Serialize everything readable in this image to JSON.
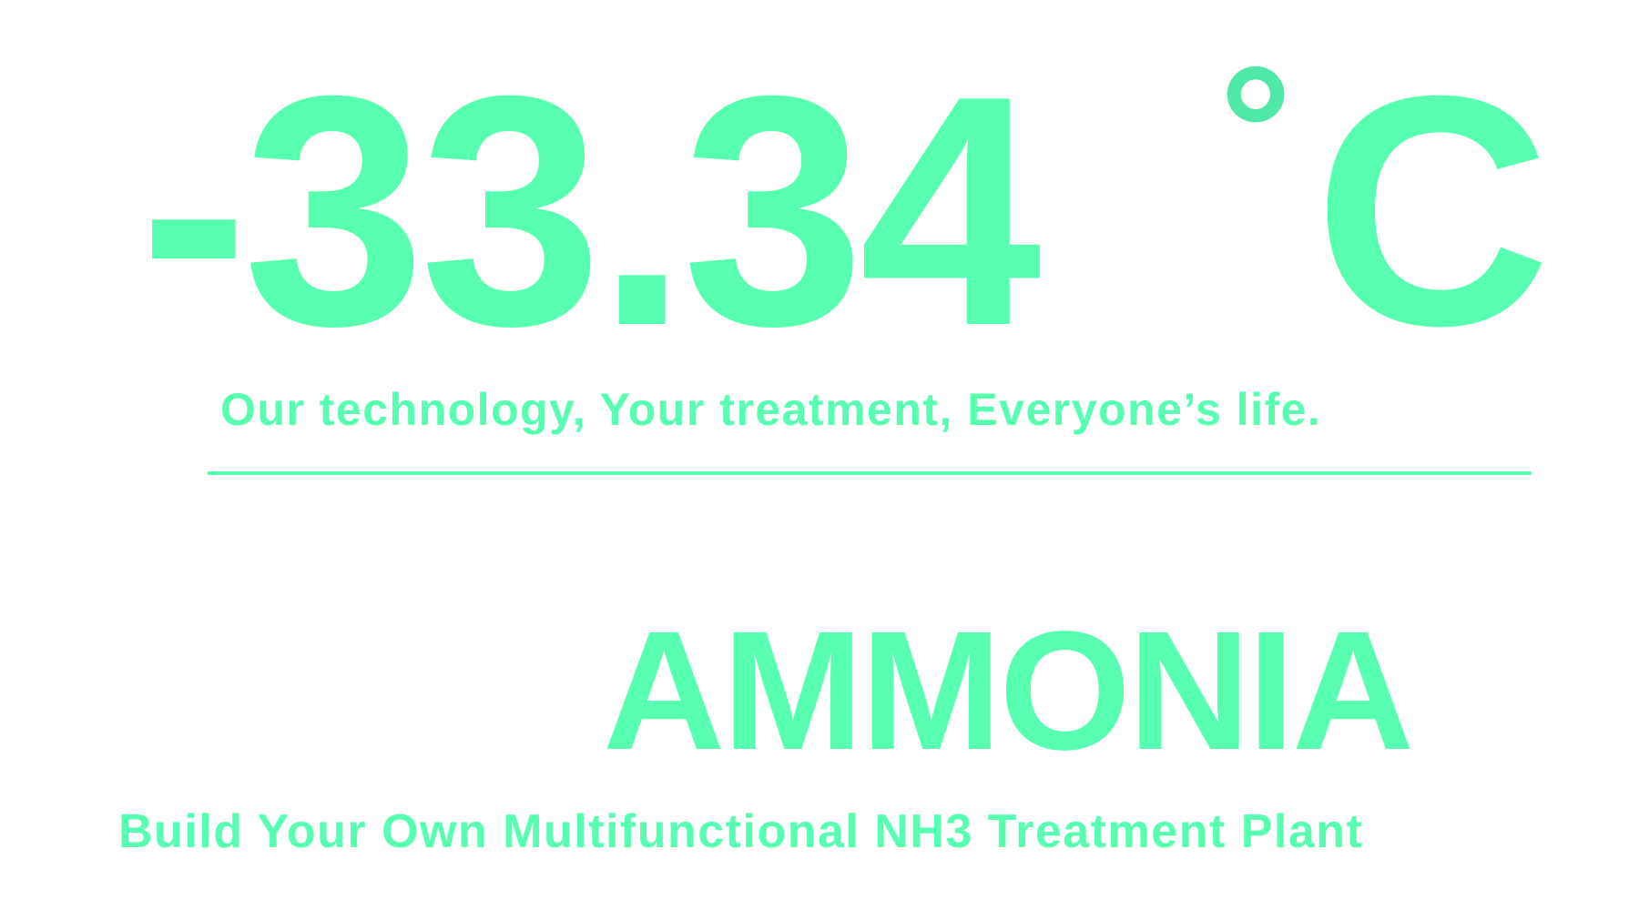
{
  "temperature": {
    "value": "-33.34",
    "degree_symbol": "°",
    "unit": "C"
  },
  "tagline": "Our technology, Your treatment, Everyone’s life.",
  "product_name": "AMMONIA",
  "subtitle": "Build Your Own Multifunctional NH3 Treatment Plant",
  "colors": {
    "accent": "#58FFB1",
    "degree": "#4FE8A8",
    "background": "#FFFFFF"
  }
}
